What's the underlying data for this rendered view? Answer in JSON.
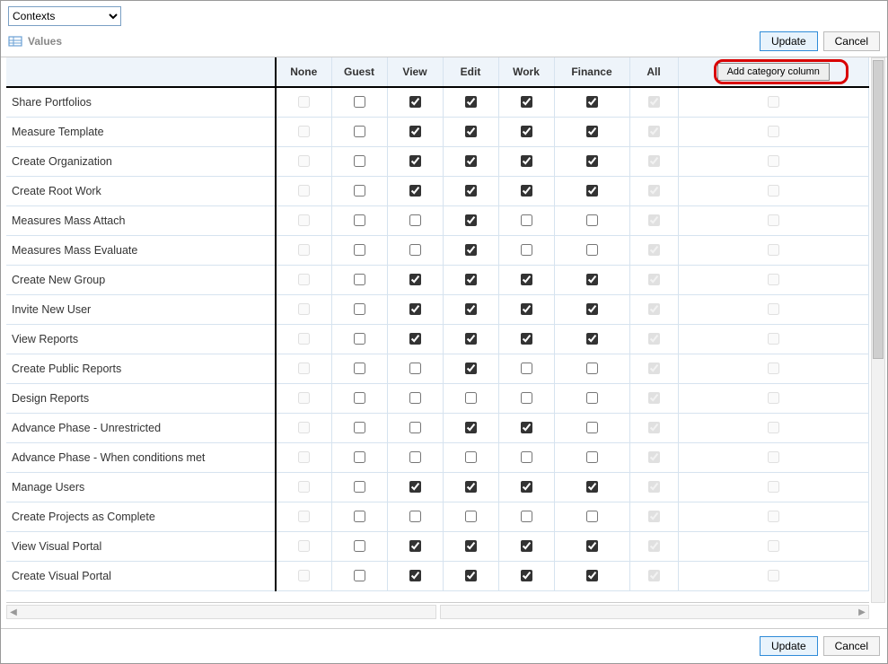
{
  "toolbar": {
    "dropdown_selected": "Contexts",
    "values_label": "Values",
    "update_label": "Update",
    "cancel_label": "Cancel",
    "add_category_label": "Add category column"
  },
  "columns": [
    "None",
    "Guest",
    "View",
    "Edit",
    "Work",
    "Finance",
    "All"
  ],
  "rows": [
    {
      "label": "Share Portfolios",
      "none": "disabled",
      "guest": false,
      "view": true,
      "edit": true,
      "work": true,
      "finance": true,
      "all": "disabled_checked",
      "extra": "disabled"
    },
    {
      "label": "Measure Template",
      "none": "disabled",
      "guest": false,
      "view": true,
      "edit": true,
      "work": true,
      "finance": true,
      "all": "disabled_checked",
      "extra": "disabled"
    },
    {
      "label": "Create Organization",
      "none": "disabled",
      "guest": false,
      "view": true,
      "edit": true,
      "work": true,
      "finance": true,
      "all": "disabled_checked",
      "extra": "disabled"
    },
    {
      "label": "Create Root Work",
      "none": "disabled",
      "guest": false,
      "view": true,
      "edit": true,
      "work": true,
      "finance": true,
      "all": "disabled_checked",
      "extra": "disabled"
    },
    {
      "label": "Measures Mass Attach",
      "none": "disabled",
      "guest": false,
      "view": false,
      "edit": true,
      "work": false,
      "finance": false,
      "all": "disabled_checked",
      "extra": "disabled"
    },
    {
      "label": "Measures Mass Evaluate",
      "none": "disabled",
      "guest": false,
      "view": false,
      "edit": true,
      "work": false,
      "finance": false,
      "all": "disabled_checked",
      "extra": "disabled"
    },
    {
      "label": "Create New Group",
      "none": "disabled",
      "guest": false,
      "view": true,
      "edit": true,
      "work": true,
      "finance": true,
      "all": "disabled_checked",
      "extra": "disabled"
    },
    {
      "label": "Invite New User",
      "none": "disabled",
      "guest": false,
      "view": true,
      "edit": true,
      "work": true,
      "finance": true,
      "all": "disabled_checked",
      "extra": "disabled"
    },
    {
      "label": "View Reports",
      "none": "disabled",
      "guest": false,
      "view": true,
      "edit": true,
      "work": true,
      "finance": true,
      "all": "disabled_checked",
      "extra": "disabled"
    },
    {
      "label": "Create Public Reports",
      "none": "disabled",
      "guest": false,
      "view": false,
      "edit": true,
      "work": false,
      "finance": false,
      "all": "disabled_checked",
      "extra": "disabled"
    },
    {
      "label": "Design Reports",
      "none": "disabled",
      "guest": false,
      "view": false,
      "edit": false,
      "work": false,
      "finance": false,
      "all": "disabled_checked",
      "extra": "disabled"
    },
    {
      "label": "Advance Phase - Unrestricted",
      "none": "disabled",
      "guest": false,
      "view": false,
      "edit": true,
      "work": true,
      "finance": false,
      "all": "disabled_checked",
      "extra": "disabled"
    },
    {
      "label": "Advance Phase - When conditions met",
      "none": "disabled",
      "guest": false,
      "view": false,
      "edit": false,
      "work": false,
      "finance": false,
      "all": "disabled_checked",
      "extra": "disabled"
    },
    {
      "label": "Manage Users",
      "none": "disabled",
      "guest": false,
      "view": true,
      "edit": true,
      "work": true,
      "finance": true,
      "all": "disabled_checked",
      "extra": "disabled"
    },
    {
      "label": "Create Projects as Complete",
      "none": "disabled",
      "guest": false,
      "view": false,
      "edit": false,
      "work": false,
      "finance": false,
      "all": "disabled_checked",
      "extra": "disabled"
    },
    {
      "label": "View Visual Portal",
      "none": "disabled",
      "guest": false,
      "view": true,
      "edit": true,
      "work": true,
      "finance": true,
      "all": "disabled_checked",
      "extra": "disabled"
    },
    {
      "label": "Create Visual Portal",
      "none": "disabled",
      "guest": false,
      "view": true,
      "edit": true,
      "work": true,
      "finance": true,
      "all": "disabled_checked",
      "extra": "disabled"
    }
  ],
  "footer": {
    "update_label": "Update",
    "cancel_label": "Cancel"
  }
}
